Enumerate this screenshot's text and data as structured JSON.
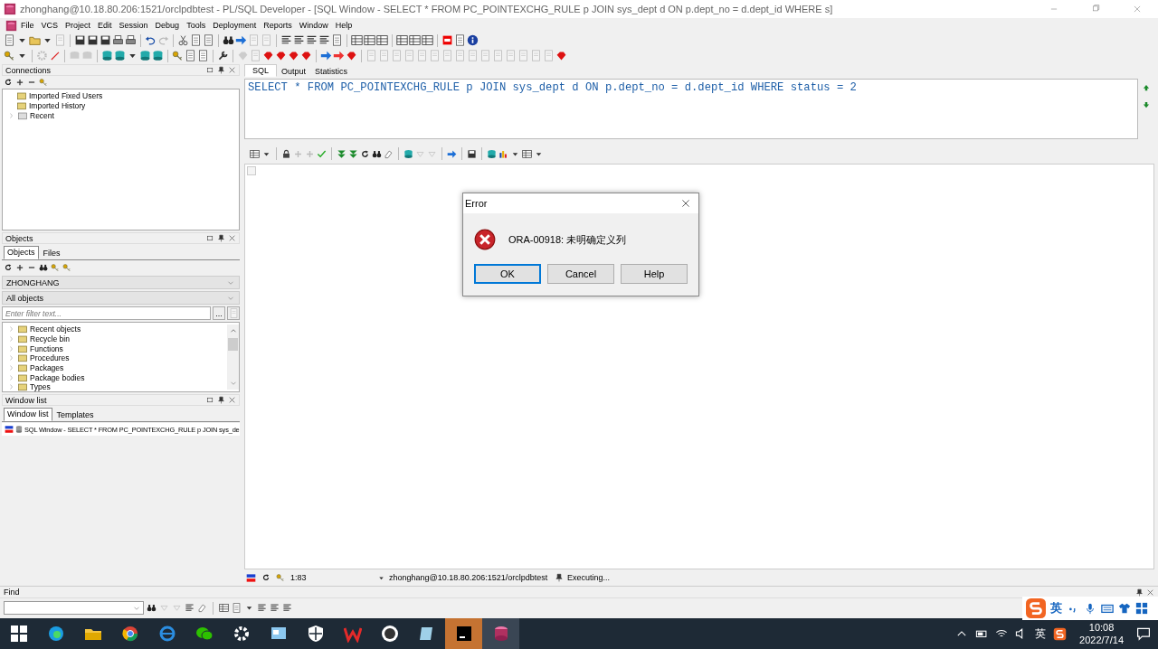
{
  "window": {
    "title": "zhonghang@10.18.80.206:1521/orclpdbtest - PL/SQL Developer - [SQL Window - SELECT * FROM PC_POINTEXCHG_RULE p JOIN sys_dept d ON p.dept_no = d.dept_id WHERE s]"
  },
  "menu": [
    "File",
    "VCS",
    "Project",
    "Edit",
    "Session",
    "Debug",
    "Tools",
    "Deployment",
    "Reports",
    "Window",
    "Help"
  ],
  "connections": {
    "title": "Connections",
    "tree": [
      {
        "label": "Imported Fixed Users",
        "expandable": false
      },
      {
        "label": "Imported History",
        "expandable": false
      },
      {
        "label": "Recent",
        "expandable": true
      }
    ]
  },
  "objects": {
    "title": "Objects",
    "tabs": [
      {
        "label": "Objects",
        "selected": true
      },
      {
        "label": "Files",
        "selected": false
      }
    ],
    "user": "ZHONGHANG",
    "filter": "All objects",
    "search_placeholder": "Enter filter text...",
    "browse": "...",
    "items": [
      "Recent objects",
      "Recycle bin",
      "Functions",
      "Procedures",
      "Packages",
      "Package bodies",
      "Types"
    ]
  },
  "window_list": {
    "title": "Window list",
    "tabs": [
      {
        "label": "Window list",
        "selected": true
      },
      {
        "label": "Templates",
        "selected": false
      }
    ],
    "items": [
      "SQL Window - SELECT * FROM PC_POINTEXCHG_RULE p JOIN sys_de"
    ]
  },
  "editor": {
    "tabs": [
      {
        "label": "SQL",
        "selected": true
      },
      {
        "label": "Output",
        "selected": false
      },
      {
        "label": "Statistics",
        "selected": false
      }
    ],
    "sql": "SELECT * FROM PC_POINTEXCHG_RULE p JOIN sys_dept d ON p.dept_no = d.dept_id WHERE status = 2"
  },
  "status": {
    "position": "1:83",
    "connection": "zhonghang@10.18.80.206:1521/orclpdbtest",
    "state": "Executing..."
  },
  "find": {
    "title": "Find"
  },
  "dialog": {
    "title": "Error",
    "message": "ORA-00918: 未明确定义列",
    "buttons": [
      {
        "label": "OK",
        "default": true
      },
      {
        "label": "Cancel",
        "default": false
      },
      {
        "label": "Help",
        "default": false
      }
    ]
  },
  "ime_bar": {
    "mode": "英"
  },
  "taskbar": {
    "ime": "英",
    "time": "10:08",
    "date": "2022/7/14"
  }
}
